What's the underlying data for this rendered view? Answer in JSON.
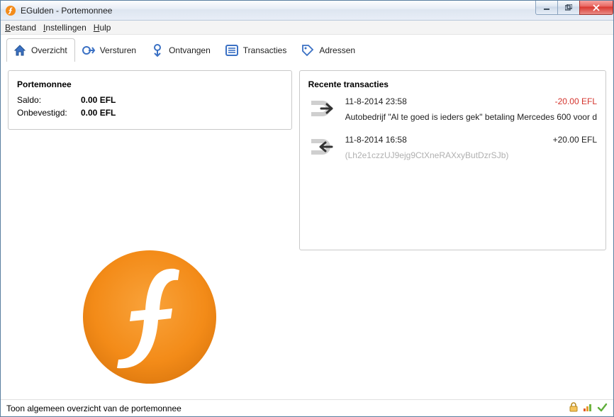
{
  "window": {
    "title": "EGulden - Portemonnee"
  },
  "menu": {
    "bestand": "Bestand",
    "instellingen": "Instellingen",
    "hulp": "Hulp"
  },
  "tabs": {
    "overzicht": "Overzicht",
    "versturen": "Versturen",
    "ontvangen": "Ontvangen",
    "transacties": "Transacties",
    "adressen": "Adressen"
  },
  "wallet": {
    "title": "Portemonnee",
    "balance_label": "Saldo:",
    "balance_value": "0.00 EFL",
    "unconfirmed_label": "Onbevestigd:",
    "unconfirmed_value": "0.00 EFL"
  },
  "recent": {
    "title": "Recente transacties",
    "items": [
      {
        "direction": "out",
        "date": "11-8-2014 23:58",
        "amount": "-20.00 EFL",
        "amount_sign": "neg",
        "desc": "Autobedrijf \"Al te goed is ieders gek\" betaling Mercedes 600 voor d",
        "muted": false
      },
      {
        "direction": "in",
        "date": "11-8-2014 16:58",
        "amount": "+20.00 EFL",
        "amount_sign": "pos",
        "desc": "(Lh2e1czzUJ9ejg9CtXneRAXxyButDzrSJb)",
        "muted": true
      }
    ]
  },
  "status": {
    "text": "Toon algemeen overzicht van de portemonnee"
  },
  "colors": {
    "brand": "#f48b1a",
    "neg": "#d4332c"
  }
}
